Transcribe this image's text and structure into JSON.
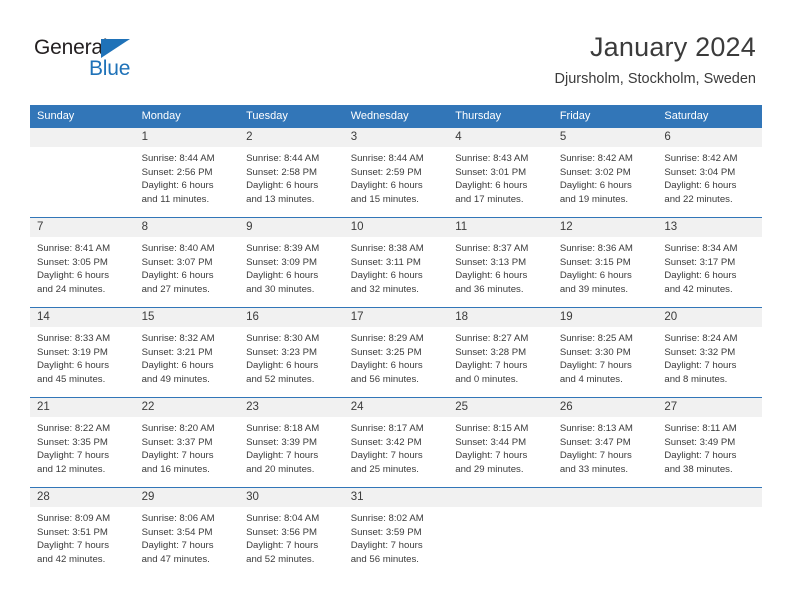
{
  "brand": {
    "name_top": "General",
    "name_bottom": "Blue",
    "triangle_color": "#1f72b8",
    "text_color": "#231f20"
  },
  "header": {
    "title": "January 2024",
    "subtitle": "Djursholm, Stockholm, Sweden"
  },
  "theme": {
    "header_bg": "#3276b8",
    "daynum_bg": "#f1f1f1",
    "text": "#3b3b3b"
  },
  "weekday_headers": [
    "Sunday",
    "Monday",
    "Tuesday",
    "Wednesday",
    "Thursday",
    "Friday",
    "Saturday"
  ],
  "weeks": [
    {
      "days": [
        {
          "date": "",
          "sunrise": "",
          "sunset": "",
          "daylight_line1": "",
          "daylight_line2": ""
        },
        {
          "date": "1",
          "sunrise": "Sunrise: 8:44 AM",
          "sunset": "Sunset: 2:56 PM",
          "daylight_line1": "Daylight: 6 hours",
          "daylight_line2": "and 11 minutes."
        },
        {
          "date": "2",
          "sunrise": "Sunrise: 8:44 AM",
          "sunset": "Sunset: 2:58 PM",
          "daylight_line1": "Daylight: 6 hours",
          "daylight_line2": "and 13 minutes."
        },
        {
          "date": "3",
          "sunrise": "Sunrise: 8:44 AM",
          "sunset": "Sunset: 2:59 PM",
          "daylight_line1": "Daylight: 6 hours",
          "daylight_line2": "and 15 minutes."
        },
        {
          "date": "4",
          "sunrise": "Sunrise: 8:43 AM",
          "sunset": "Sunset: 3:01 PM",
          "daylight_line1": "Daylight: 6 hours",
          "daylight_line2": "and 17 minutes."
        },
        {
          "date": "5",
          "sunrise": "Sunrise: 8:42 AM",
          "sunset": "Sunset: 3:02 PM",
          "daylight_line1": "Daylight: 6 hours",
          "daylight_line2": "and 19 minutes."
        },
        {
          "date": "6",
          "sunrise": "Sunrise: 8:42 AM",
          "sunset": "Sunset: 3:04 PM",
          "daylight_line1": "Daylight: 6 hours",
          "daylight_line2": "and 22 minutes."
        }
      ]
    },
    {
      "days": [
        {
          "date": "7",
          "sunrise": "Sunrise: 8:41 AM",
          "sunset": "Sunset: 3:05 PM",
          "daylight_line1": "Daylight: 6 hours",
          "daylight_line2": "and 24 minutes."
        },
        {
          "date": "8",
          "sunrise": "Sunrise: 8:40 AM",
          "sunset": "Sunset: 3:07 PM",
          "daylight_line1": "Daylight: 6 hours",
          "daylight_line2": "and 27 minutes."
        },
        {
          "date": "9",
          "sunrise": "Sunrise: 8:39 AM",
          "sunset": "Sunset: 3:09 PM",
          "daylight_line1": "Daylight: 6 hours",
          "daylight_line2": "and 30 minutes."
        },
        {
          "date": "10",
          "sunrise": "Sunrise: 8:38 AM",
          "sunset": "Sunset: 3:11 PM",
          "daylight_line1": "Daylight: 6 hours",
          "daylight_line2": "and 32 minutes."
        },
        {
          "date": "11",
          "sunrise": "Sunrise: 8:37 AM",
          "sunset": "Sunset: 3:13 PM",
          "daylight_line1": "Daylight: 6 hours",
          "daylight_line2": "and 36 minutes."
        },
        {
          "date": "12",
          "sunrise": "Sunrise: 8:36 AM",
          "sunset": "Sunset: 3:15 PM",
          "daylight_line1": "Daylight: 6 hours",
          "daylight_line2": "and 39 minutes."
        },
        {
          "date": "13",
          "sunrise": "Sunrise: 8:34 AM",
          "sunset": "Sunset: 3:17 PM",
          "daylight_line1": "Daylight: 6 hours",
          "daylight_line2": "and 42 minutes."
        }
      ]
    },
    {
      "days": [
        {
          "date": "14",
          "sunrise": "Sunrise: 8:33 AM",
          "sunset": "Sunset: 3:19 PM",
          "daylight_line1": "Daylight: 6 hours",
          "daylight_line2": "and 45 minutes."
        },
        {
          "date": "15",
          "sunrise": "Sunrise: 8:32 AM",
          "sunset": "Sunset: 3:21 PM",
          "daylight_line1": "Daylight: 6 hours",
          "daylight_line2": "and 49 minutes."
        },
        {
          "date": "16",
          "sunrise": "Sunrise: 8:30 AM",
          "sunset": "Sunset: 3:23 PM",
          "daylight_line1": "Daylight: 6 hours",
          "daylight_line2": "and 52 minutes."
        },
        {
          "date": "17",
          "sunrise": "Sunrise: 8:29 AM",
          "sunset": "Sunset: 3:25 PM",
          "daylight_line1": "Daylight: 6 hours",
          "daylight_line2": "and 56 minutes."
        },
        {
          "date": "18",
          "sunrise": "Sunrise: 8:27 AM",
          "sunset": "Sunset: 3:28 PM",
          "daylight_line1": "Daylight: 7 hours",
          "daylight_line2": "and 0 minutes."
        },
        {
          "date": "19",
          "sunrise": "Sunrise: 8:25 AM",
          "sunset": "Sunset: 3:30 PM",
          "daylight_line1": "Daylight: 7 hours",
          "daylight_line2": "and 4 minutes."
        },
        {
          "date": "20",
          "sunrise": "Sunrise: 8:24 AM",
          "sunset": "Sunset: 3:32 PM",
          "daylight_line1": "Daylight: 7 hours",
          "daylight_line2": "and 8 minutes."
        }
      ]
    },
    {
      "days": [
        {
          "date": "21",
          "sunrise": "Sunrise: 8:22 AM",
          "sunset": "Sunset: 3:35 PM",
          "daylight_line1": "Daylight: 7 hours",
          "daylight_line2": "and 12 minutes."
        },
        {
          "date": "22",
          "sunrise": "Sunrise: 8:20 AM",
          "sunset": "Sunset: 3:37 PM",
          "daylight_line1": "Daylight: 7 hours",
          "daylight_line2": "and 16 minutes."
        },
        {
          "date": "23",
          "sunrise": "Sunrise: 8:18 AM",
          "sunset": "Sunset: 3:39 PM",
          "daylight_line1": "Daylight: 7 hours",
          "daylight_line2": "and 20 minutes."
        },
        {
          "date": "24",
          "sunrise": "Sunrise: 8:17 AM",
          "sunset": "Sunset: 3:42 PM",
          "daylight_line1": "Daylight: 7 hours",
          "daylight_line2": "and 25 minutes."
        },
        {
          "date": "25",
          "sunrise": "Sunrise: 8:15 AM",
          "sunset": "Sunset: 3:44 PM",
          "daylight_line1": "Daylight: 7 hours",
          "daylight_line2": "and 29 minutes."
        },
        {
          "date": "26",
          "sunrise": "Sunrise: 8:13 AM",
          "sunset": "Sunset: 3:47 PM",
          "daylight_line1": "Daylight: 7 hours",
          "daylight_line2": "and 33 minutes."
        },
        {
          "date": "27",
          "sunrise": "Sunrise: 8:11 AM",
          "sunset": "Sunset: 3:49 PM",
          "daylight_line1": "Daylight: 7 hours",
          "daylight_line2": "and 38 minutes."
        }
      ]
    },
    {
      "days": [
        {
          "date": "28",
          "sunrise": "Sunrise: 8:09 AM",
          "sunset": "Sunset: 3:51 PM",
          "daylight_line1": "Daylight: 7 hours",
          "daylight_line2": "and 42 minutes."
        },
        {
          "date": "29",
          "sunrise": "Sunrise: 8:06 AM",
          "sunset": "Sunset: 3:54 PM",
          "daylight_line1": "Daylight: 7 hours",
          "daylight_line2": "and 47 minutes."
        },
        {
          "date": "30",
          "sunrise": "Sunrise: 8:04 AM",
          "sunset": "Sunset: 3:56 PM",
          "daylight_line1": "Daylight: 7 hours",
          "daylight_line2": "and 52 minutes."
        },
        {
          "date": "31",
          "sunrise": "Sunrise: 8:02 AM",
          "sunset": "Sunset: 3:59 PM",
          "daylight_line1": "Daylight: 7 hours",
          "daylight_line2": "and 56 minutes."
        },
        {
          "date": "",
          "sunrise": "",
          "sunset": "",
          "daylight_line1": "",
          "daylight_line2": ""
        },
        {
          "date": "",
          "sunrise": "",
          "sunset": "",
          "daylight_line1": "",
          "daylight_line2": ""
        },
        {
          "date": "",
          "sunrise": "",
          "sunset": "",
          "daylight_line1": "",
          "daylight_line2": ""
        }
      ]
    }
  ]
}
